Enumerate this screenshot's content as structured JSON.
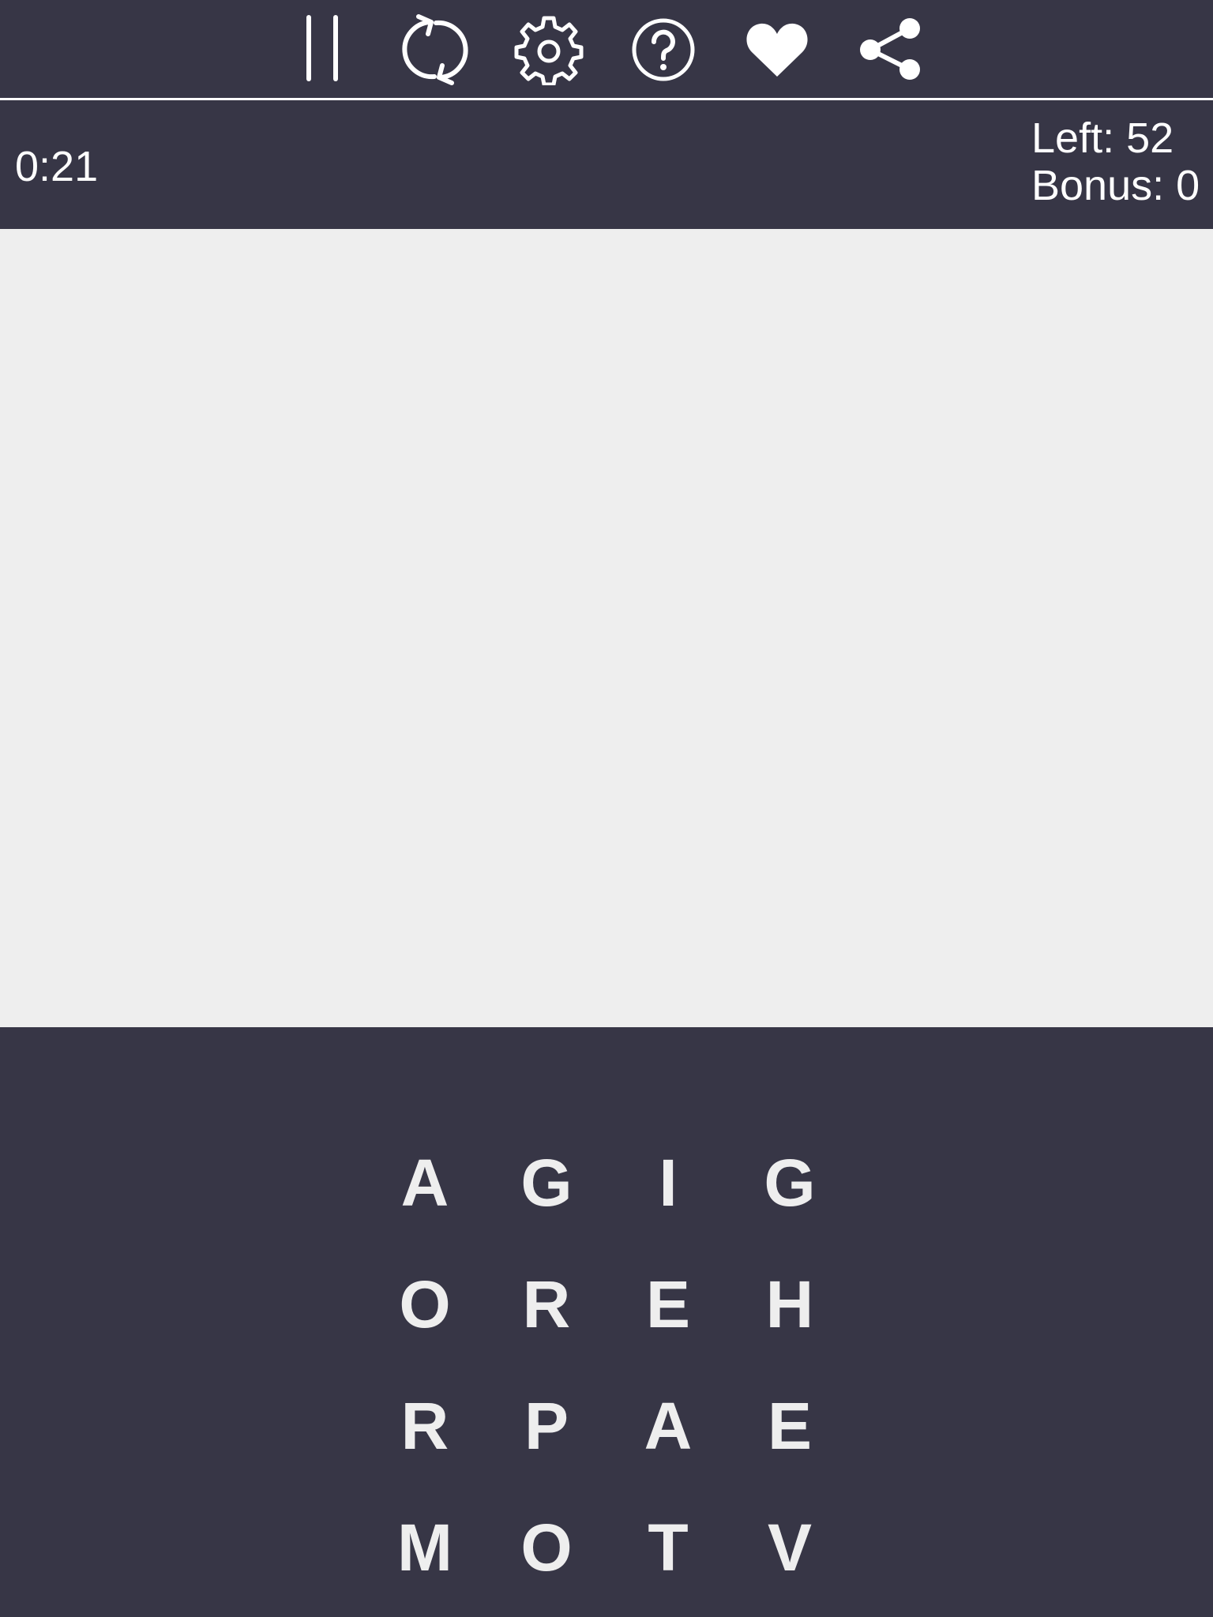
{
  "theme": {
    "background": "#373646",
    "play_area": "#eeeeee",
    "foreground": "#ffffff"
  },
  "toolbar": {
    "buttons": [
      {
        "name": "pause-icon"
      },
      {
        "name": "restart-icon"
      },
      {
        "name": "settings-gear-icon"
      },
      {
        "name": "help-question-icon"
      },
      {
        "name": "heart-icon"
      },
      {
        "name": "share-icon"
      }
    ]
  },
  "status": {
    "timer": "0:21",
    "left": "Left: 52",
    "bonus": "Bonus: 0"
  },
  "board": {
    "rows": [
      [
        "A",
        "G",
        "I",
        "G"
      ],
      [
        "O",
        "R",
        "E",
        "H"
      ],
      [
        "R",
        "P",
        "A",
        "E"
      ],
      [
        "M",
        "O",
        "T",
        "V"
      ]
    ]
  }
}
